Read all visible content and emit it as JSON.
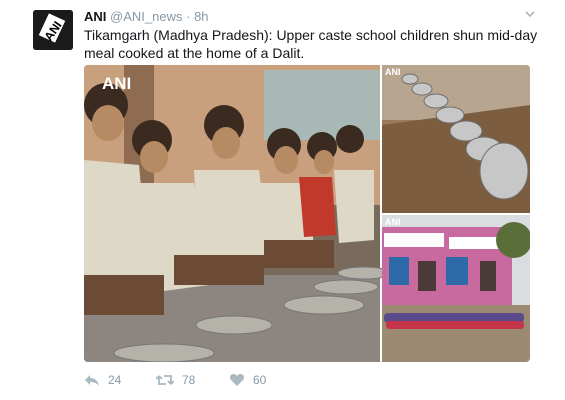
{
  "account": {
    "name": "ANI",
    "handle": "@ANI_news",
    "separator": "·",
    "time": "8h",
    "avatar_text": "ANI"
  },
  "tweet": {
    "text": "Tikamgarh (Madhya Pradesh): Upper caste school children shun mid-day meal cooked at the home of a Dalit."
  },
  "media": {
    "watermark": "ANI"
  },
  "actions": {
    "reply_count": "24",
    "retweet_count": "78",
    "like_count": "60"
  },
  "icons": {
    "reply": "reply-icon",
    "retweet": "retweet-icon",
    "like": "heart-icon",
    "more": "chevron-down-icon"
  },
  "colors": {
    "meta": "#8899a6",
    "text": "#14171a"
  }
}
